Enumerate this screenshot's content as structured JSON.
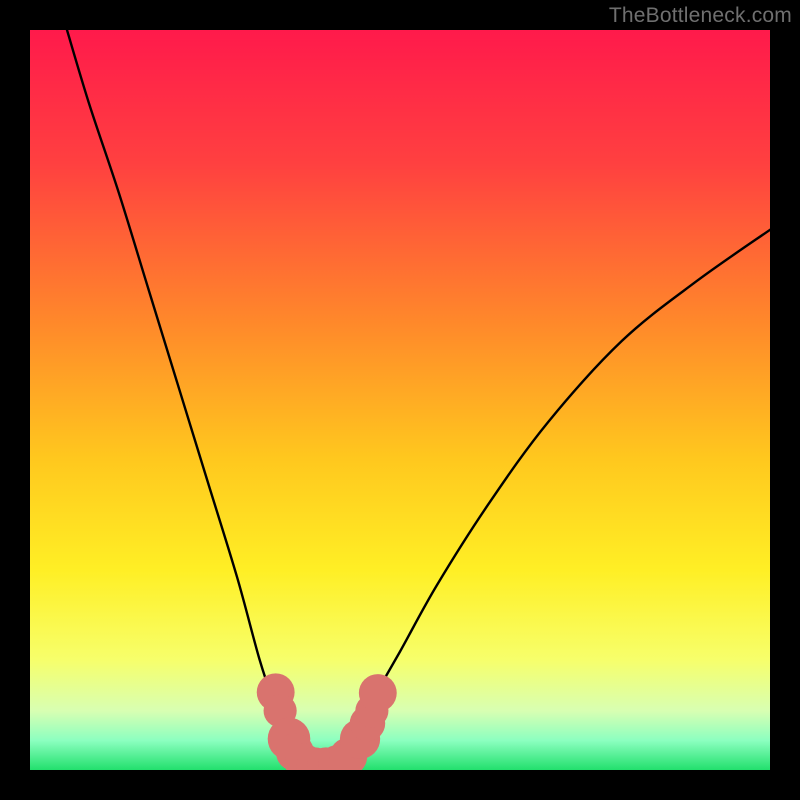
{
  "watermark": "TheBottleneck.com",
  "colors": {
    "curve_stroke": "#000000",
    "marker_fill": "#d9736e",
    "marker_stroke": "#d9736e",
    "gradient_stops": [
      {
        "offset": "0%",
        "color": "#ff1a4b"
      },
      {
        "offset": "18%",
        "color": "#ff4040"
      },
      {
        "offset": "40%",
        "color": "#ff8a2a"
      },
      {
        "offset": "58%",
        "color": "#ffc81e"
      },
      {
        "offset": "73%",
        "color": "#ffef25"
      },
      {
        "offset": "85%",
        "color": "#f7ff6a"
      },
      {
        "offset": "92%",
        "color": "#d8ffb2"
      },
      {
        "offset": "96%",
        "color": "#8cffc0"
      },
      {
        "offset": "100%",
        "color": "#22e06d"
      }
    ]
  },
  "chart_data": {
    "type": "line",
    "title": "",
    "xlabel": "",
    "ylabel": "",
    "xlim": [
      0,
      100
    ],
    "ylim": [
      0,
      100
    ],
    "series": [
      {
        "name": "bottleneck-curve",
        "x": [
          5,
          8,
          12,
          16,
          20,
          24,
          28,
          31,
          33,
          35,
          36.5,
          38,
          39.5,
          41,
          43,
          46,
          50,
          55,
          62,
          70,
          80,
          90,
          100
        ],
        "y": [
          100,
          90,
          78,
          65,
          52,
          39,
          26,
          15,
          9,
          4,
          1.5,
          0.5,
          0.5,
          1.5,
          4,
          9,
          16,
          25,
          36,
          47,
          58,
          66,
          73
        ]
      }
    ],
    "markers": {
      "name": "highlighted-points",
      "points": [
        {
          "x": 33.2,
          "y": 10.5,
          "r": 1.6
        },
        {
          "x": 33.8,
          "y": 8.0,
          "r": 1.4
        },
        {
          "x": 35.0,
          "y": 4.2,
          "r": 1.8
        },
        {
          "x": 35.8,
          "y": 2.4,
          "r": 1.6
        },
        {
          "x": 37.0,
          "y": 1.0,
          "r": 1.6
        },
        {
          "x": 38.5,
          "y": 0.5,
          "r": 1.6
        },
        {
          "x": 40.0,
          "y": 0.5,
          "r": 1.6
        },
        {
          "x": 41.5,
          "y": 0.8,
          "r": 1.6
        },
        {
          "x": 43.0,
          "y": 1.8,
          "r": 1.6
        },
        {
          "x": 44.6,
          "y": 4.2,
          "r": 1.7
        },
        {
          "x": 45.6,
          "y": 6.3,
          "r": 1.5
        },
        {
          "x": 46.2,
          "y": 8.0,
          "r": 1.4
        },
        {
          "x": 47.0,
          "y": 10.4,
          "r": 1.6
        }
      ]
    }
  }
}
